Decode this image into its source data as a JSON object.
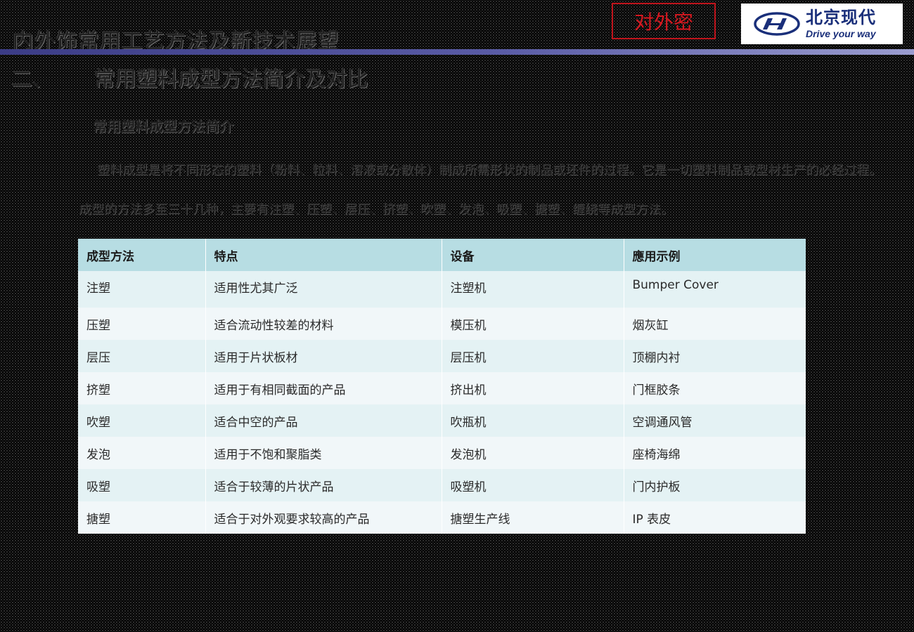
{
  "header": {
    "title": "内外饰常用工艺方法及新技术展望",
    "confidential_label": "对外密",
    "logo": {
      "icon": "hyundai-logo-icon",
      "name_cn": "北京现代",
      "slogan": "Drive your way",
      "brand_color": "#1a2f7a"
    },
    "bar_color": "#3b3c86"
  },
  "section": {
    "number": "二、",
    "title": "常用塑料成型方法简介及对比"
  },
  "intro": {
    "bullet_heading": "常用塑料成型方法简介",
    "line1": "塑料成型是将不同形态的塑料（粉料、粒料、溶液或分散体）制成所需形状的制品或坯件的过程。它是一切塑料制品或型材生产的必经过程。",
    "line2": "成型的方法多至三十几种，主要有注塑、压塑、层压、挤塑、吹塑、发泡、吸塑、搪塑、缠绕等成型方法。"
  },
  "table": {
    "headers": [
      "成型方法",
      "特点",
      "设备",
      "應用示例"
    ],
    "rows": [
      [
        "注塑",
        "适用性尤其广泛",
        "注塑机",
        "Bumper Cover"
      ],
      [
        "压塑",
        "适合流动性较差的材料",
        "模压机",
        "烟灰缸"
      ],
      [
        "层压",
        "适用于片状板材",
        "层压机",
        "顶棚内衬"
      ],
      [
        "挤塑",
        "适用于有相同截面的产品",
        "挤出机",
        "门框胶条"
      ],
      [
        "吹塑",
        "适合中空的产品",
        "吹瓶机",
        "空调通风管"
      ],
      [
        "发泡",
        "适用于不饱和聚脂类",
        "发泡机",
        "座椅海绵"
      ],
      [
        "吸塑",
        "适合于较薄的片状产品",
        "吸塑机",
        "门内护板"
      ],
      [
        "搪塑",
        "适合于对外观要求较高的产品",
        "搪塑生产线",
        "IP 表皮"
      ]
    ],
    "header_color": "#b7dde3",
    "row_color_a": "#e4f2f4",
    "row_color_b": "#f1f7f9"
  },
  "colors": {
    "confidential": "#d81820"
  }
}
